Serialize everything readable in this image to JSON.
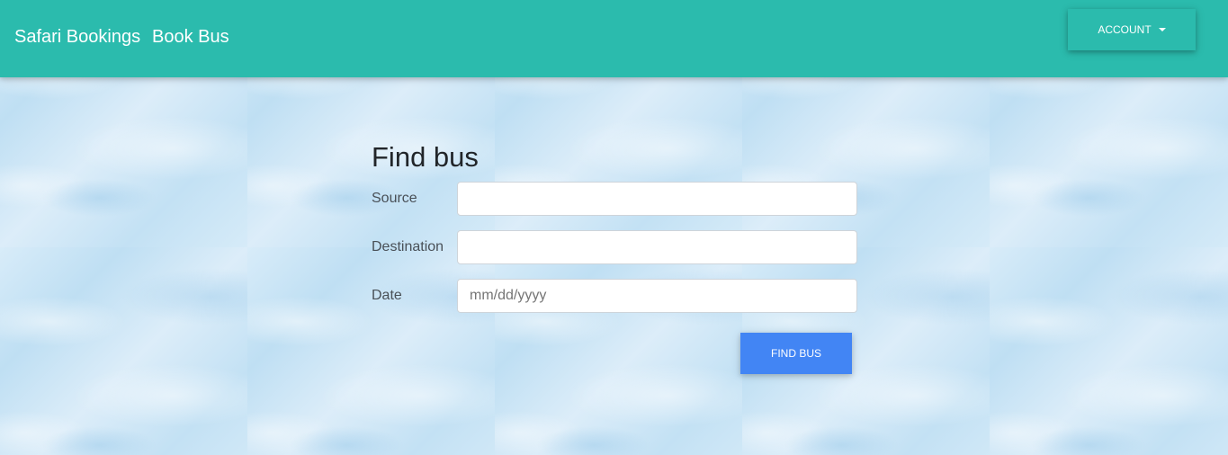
{
  "navbar": {
    "brand": "Safari Bookings",
    "link": "Book Bus",
    "account_label": "ACCOUNT",
    "color": "#2bbbad"
  },
  "form": {
    "title": "Find bus",
    "source_label": "Source",
    "source_value": "",
    "destination_label": "Destination",
    "destination_value": "",
    "date_label": "Date",
    "date_placeholder": "mm/dd/yyyy",
    "submit_label": "FIND BUS",
    "submit_color": "#4285f4"
  }
}
